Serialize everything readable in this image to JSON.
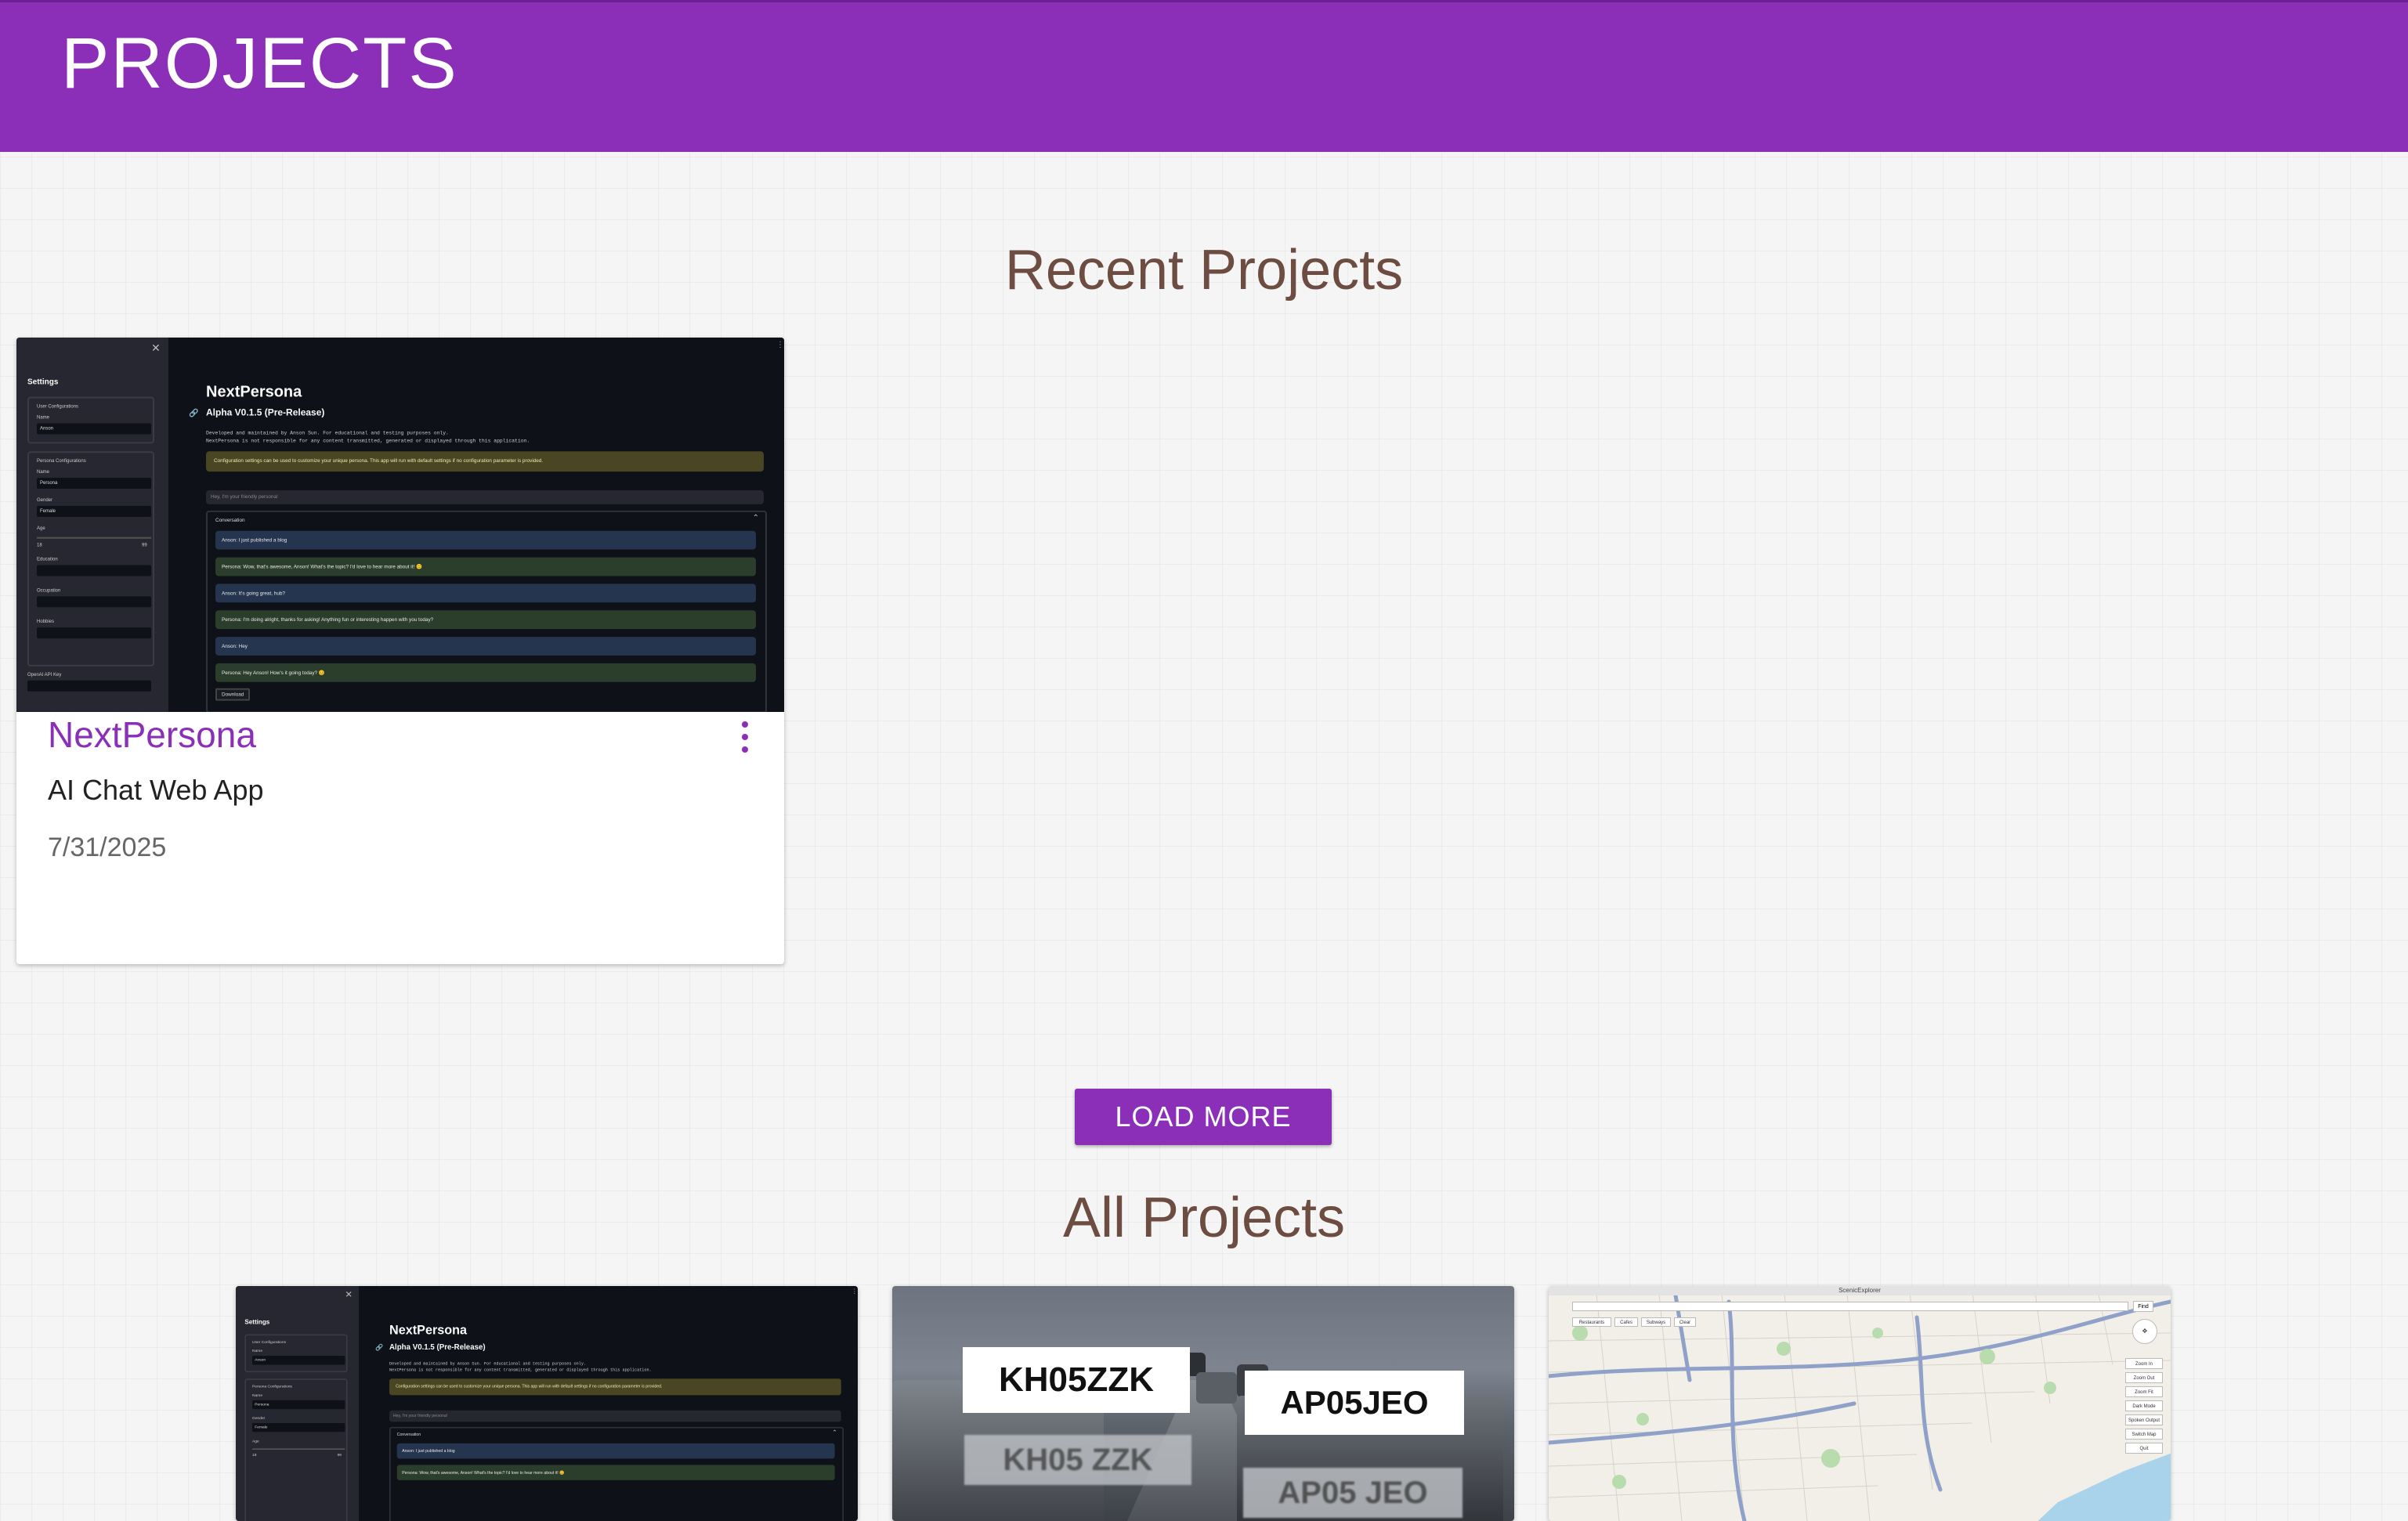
{
  "appbar": {
    "title": "PROJECTS"
  },
  "recent": {
    "heading": "Recent Projects",
    "cards": [
      {
        "title": "NextPersona",
        "subtitle": "AI Chat Web App",
        "date": "7/31/2025"
      }
    ],
    "load_more_label": "LOAD MORE"
  },
  "all": {
    "heading": "All Projects"
  },
  "preview": {
    "settings": "Settings",
    "user_config": "User Configurations",
    "name_label": "Name",
    "user_name": "Anson",
    "persona_config": "Persona Configurations",
    "persona_name": "Persona",
    "gender_label": "Gender",
    "gender": "Female",
    "age_label": "Age",
    "age_min": "18",
    "age_max": "99",
    "education_label": "Education",
    "occupation_label": "Occupation",
    "hobbies_label": "Hobbies",
    "api_key_label": "OpenAI API Key",
    "app_title": "NextPersona",
    "version": "Alpha V0.1.5 (Pre-Release)",
    "note_line1": "Developed and maintained by Anson Sun. For educational and testing purposes only.",
    "note_line2": "NextPersona is not responsible for any content transmitted, generated or displayed through this application.",
    "warning": "Configuration settings can be used to customize your unique persona. This app will run with default settings if no configuration parameter is provided.",
    "chat_placeholder": "Hey, I'm your friendly persona!",
    "conversation_label": "Conversation",
    "messages": [
      {
        "role": "u",
        "text": "Anson: I just published a blog"
      },
      {
        "role": "p",
        "text": "Persona: Wow, that's awesome, Anson! What's the topic? I'd love to hear more about it! 😊"
      },
      {
        "role": "u",
        "text": "Anson: It's going great, hub?"
      },
      {
        "role": "p",
        "text": "Persona: I'm doing alright, thanks for asking! Anything fun or interesting happen with you today?"
      },
      {
        "role": "u",
        "text": "Anson: Hey"
      },
      {
        "role": "p",
        "text": "Persona: Hey Anson! How's it going today? 😊"
      }
    ],
    "download_label": "Download"
  },
  "plates": {
    "label1": "KH05ZZK",
    "real1": "KH05 ZZK",
    "label2": "AP05JEO",
    "real2": "AP05 JEO"
  },
  "map": {
    "title": "ScenicExplorer",
    "find_label": "Find",
    "buttons": [
      "Restaurants",
      "Cafes",
      "Subways",
      "Clear"
    ],
    "controls": [
      "Zoom In",
      "Zoom Out",
      "Zoom Fit",
      "Dark Mode",
      "Spoken Output",
      "Switch Map",
      "Quit"
    ]
  },
  "colors": {
    "brand": "#8b2fb8",
    "heading": "#6d4c41"
  }
}
